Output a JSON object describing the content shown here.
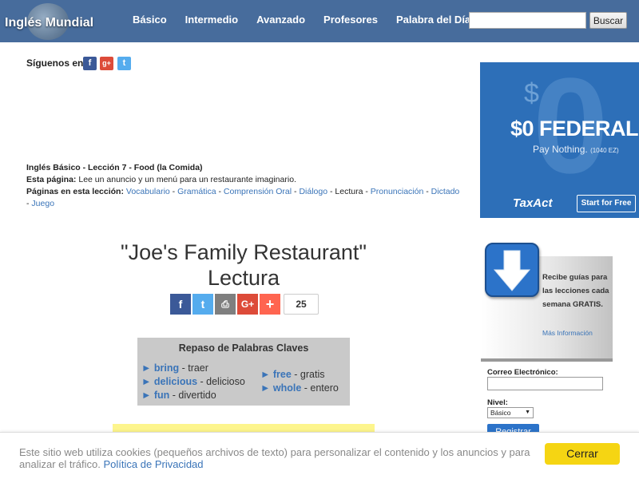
{
  "header": {
    "logo_text": "Inglés Mundial",
    "nav": [
      "Básico",
      "Intermedio",
      "Avanzado",
      "Profesores",
      "Palabra del Día"
    ],
    "search": {
      "value": "",
      "button_label": "Buscar"
    },
    "bg_color": "#476c9c"
  },
  "follow": {
    "label": "Síguenos en",
    "icons": [
      "facebook-icon",
      "google-plus-icon",
      "twitter-icon"
    ]
  },
  "lesson": {
    "heading": "Inglés Básico - Lección 7 - Food (la Comida)",
    "page_label": "Esta página:",
    "page_desc": " Lee un anuncio y un menú para un restaurante imaginario.",
    "pages_label": "Páginas en esta lección:",
    "links": [
      "Vocabulario",
      "Gramática",
      "Comprensión Oral",
      "Diálogo",
      "Lectura",
      "Pronunciación",
      "Dictado",
      "Juego"
    ],
    "current": "Lectura",
    "separator": " - "
  },
  "ad": {
    "headline": "$0 FEDERAL",
    "sub": "Pay Nothing.",
    "sub_small": "(1040 EZ)",
    "brand": "TaxAct",
    "cta": "Start for Free",
    "color": "#2d6fb8"
  },
  "title": {
    "line1": "\"Joe's Family Restaurant\"",
    "line2": "Lectura"
  },
  "share": {
    "buttons": [
      "f",
      "t",
      "⎙",
      "G+",
      "+"
    ],
    "count": "25"
  },
  "keywords": {
    "title": "Repaso de Palabras Claves",
    "col1": [
      {
        "word": "bring",
        "meaning": " - traer"
      },
      {
        "word": "delicious",
        "meaning": " - delicioso"
      },
      {
        "word": "fun",
        "meaning": " - divertido"
      }
    ],
    "col2": [
      {
        "word": "free",
        "meaning": " - gratis"
      },
      {
        "word": "whole",
        "meaning": " - entero"
      }
    ]
  },
  "newsletter": {
    "text": "Recibe guías para las lecciones cada semana GRATIS.",
    "more": "Más Información",
    "email_label": "Correo Electrónico:",
    "level_label": "Nivel:",
    "level_value": "Básico",
    "register_label": "Registrar"
  },
  "cookie": {
    "message": "Este sitio web utiliza cookies (pequeños archivos de texto) para personalizar el contenido y los anuncios y para analizar el tráfico. ",
    "policy_link": "Política de Privacidad",
    "close_label": "Cerrar",
    "button_color": "#f5d513"
  }
}
